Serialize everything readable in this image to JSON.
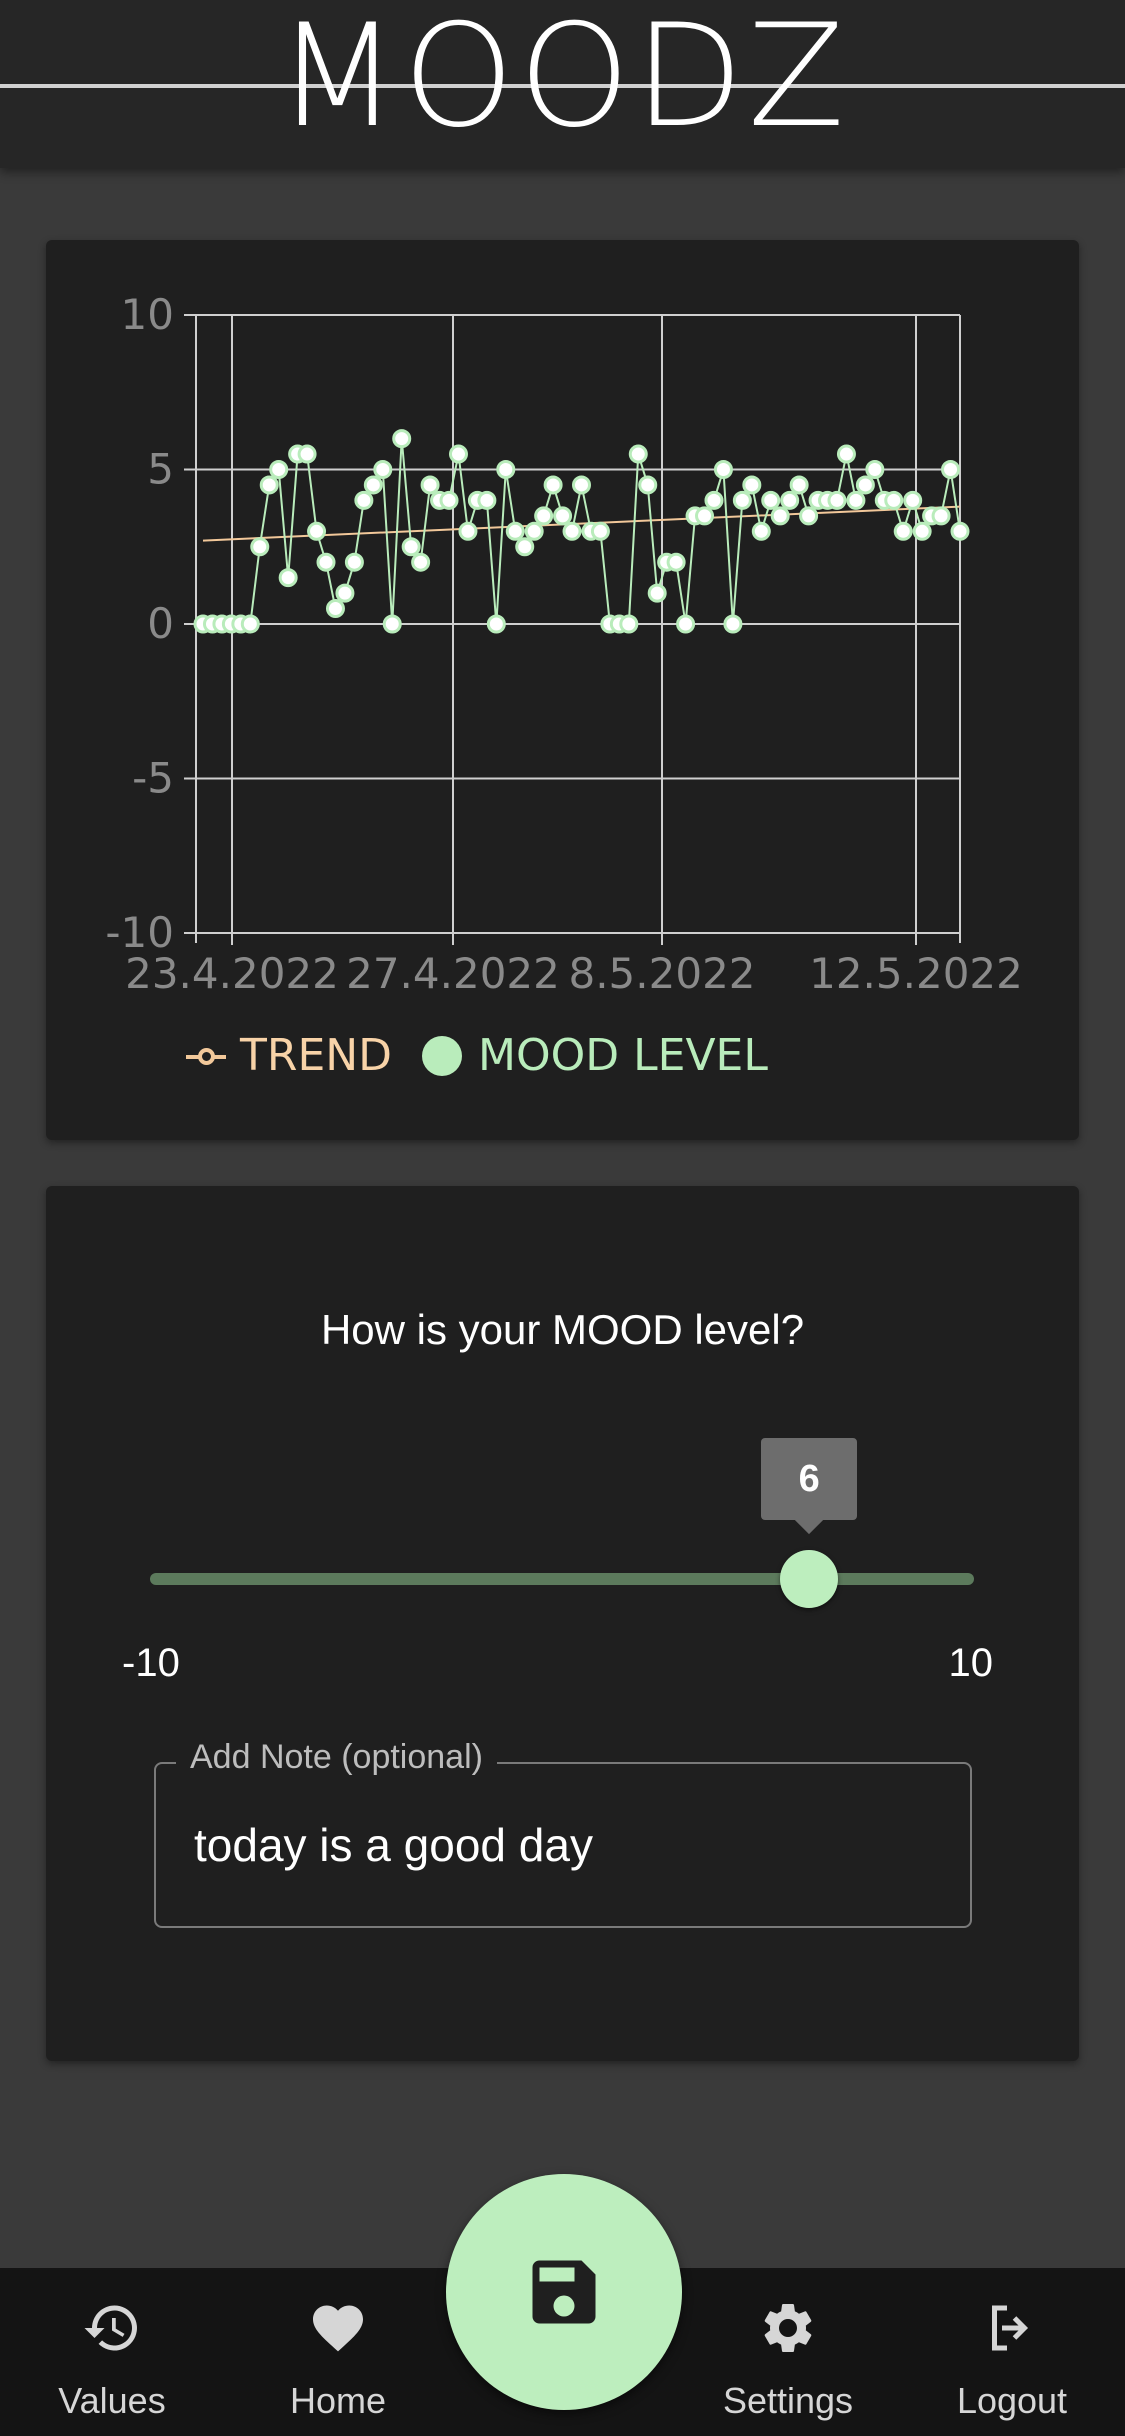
{
  "header": {
    "title": "MOODZ"
  },
  "chart_data": {
    "type": "line",
    "x_tick_labels": [
      "23.4.2022",
      "27.4.2022",
      "8.5.2022",
      "12.5.2022"
    ],
    "y_tick_labels": [
      "10",
      "5",
      "0",
      "-5",
      "-10"
    ],
    "ylim": [
      -10,
      10
    ],
    "grid": true,
    "legend_position": "bottom-left",
    "legend": {
      "trend_label": "TREND",
      "mood_label": "MOOD LEVEL"
    },
    "series": [
      {
        "name": "MOOD LEVEL",
        "color": "#b9ecbb",
        "values": [
          0,
          0,
          0,
          0,
          0,
          0,
          2.5,
          4.5,
          5,
          1.5,
          5.5,
          5.5,
          3,
          2,
          0.5,
          1,
          2,
          4,
          4.5,
          5,
          0,
          6,
          2.5,
          2,
          4.5,
          4,
          4,
          5.5,
          3,
          4,
          4,
          0,
          5,
          3,
          2.5,
          3,
          3.5,
          4.5,
          3.5,
          3,
          4.5,
          3,
          3,
          0,
          0,
          0,
          5.5,
          4.5,
          1,
          2,
          2,
          0,
          3.5,
          3.5,
          4,
          5,
          0,
          4,
          4.5,
          3,
          4,
          3.5,
          4,
          4.5,
          3.5,
          4,
          4,
          4,
          5.5,
          4,
          4.5,
          5,
          4,
          4,
          3,
          4,
          3,
          3.5,
          3.5,
          5,
          3
        ]
      },
      {
        "name": "TREND",
        "color": "#f2c89a",
        "start": 2.7,
        "end": 3.8
      }
    ]
  },
  "form": {
    "question": "How is your MOOD level?",
    "slider": {
      "value": 6,
      "min": -10,
      "max": 10,
      "min_label": "-10",
      "max_label": "10",
      "value_label": "6"
    },
    "note": {
      "label": "Add Note (optional)",
      "value": "today is a good day"
    }
  },
  "nav": {
    "values_label": "Values",
    "home_label": "Home",
    "settings_label": "Settings",
    "logout_label": "Logout"
  },
  "colors": {
    "accent": "#bdeebe",
    "trend": "#f2c89a",
    "background": "#3a3a3a",
    "card": "#1f1f1f"
  }
}
